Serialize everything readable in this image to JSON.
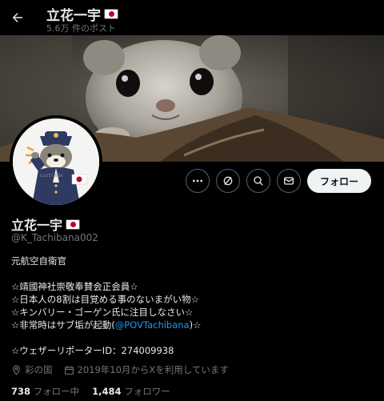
{
  "header": {
    "title": "立花一宇",
    "post_count": "5.6万 件のポスト"
  },
  "profile": {
    "name": "立花一宇",
    "handle": "@K_Tachibana002",
    "avatar_text": "ILLUST BOX",
    "follow_label": "フォロー"
  },
  "bio": {
    "line1": "元航空自衛官",
    "line2": "☆靖國神社崇敬奉賛会正会員☆",
    "line3": "☆日本人の8割は目覚める事のないまがい物☆",
    "line4": "☆キンバリー・ゴーゲン氏に注目しなさい☆",
    "line5_pre": "☆非常時はサブ垢が起動(",
    "line5_link": "@POVTachibana",
    "line5_post": ")☆",
    "line6": "☆ウェザーリポーターID：274009938"
  },
  "meta": {
    "location": "彩の国",
    "joined": "2019年10月からXを利用しています"
  },
  "stats": {
    "following_count": "738",
    "following_label": "フォロー中",
    "followers_count": "1,484",
    "followers_label": "フォロワー"
  },
  "colors": {
    "background": "#000000",
    "link": "#1d9bf0",
    "muted": "#71767b",
    "flag_red": "#bc002d"
  },
  "icons": [
    "back-arrow-icon",
    "more-icon",
    "grok-icon",
    "search-icon",
    "mail-icon",
    "location-icon",
    "calendar-icon",
    "japan-flag-icon"
  ]
}
